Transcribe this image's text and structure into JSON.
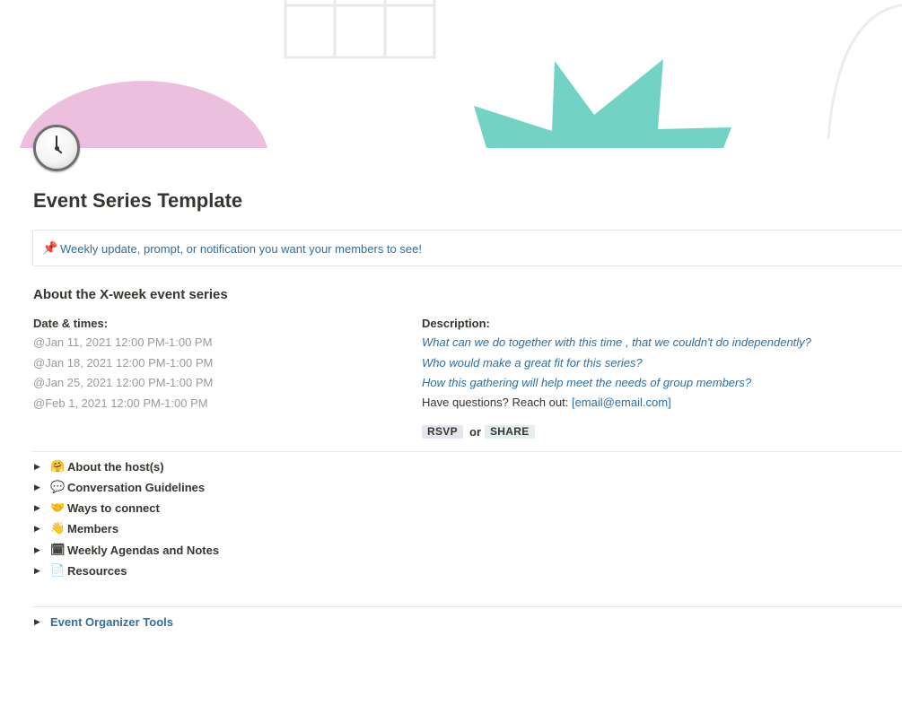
{
  "page": {
    "title": "Event Series Template",
    "icon": "clock-icon"
  },
  "callout": {
    "icon": "📌",
    "text": "Weekly update, prompt, or notification you want your members to see!"
  },
  "about": {
    "heading": "About the X-week event series",
    "dates_header": "Date & times:",
    "dates": [
      "@Jan 11, 2021 12:00 PM-1:00 PM",
      "@Jan 18, 2021 12:00 PM-1:00 PM",
      "@Jan 25, 2021 12:00 PM-1:00 PM",
      "@Feb 1, 2021 12:00 PM-1:00 PM"
    ],
    "description_header": "Description:",
    "questions": [
      "What can we do together with this time , that we couldn't do independently?",
      "Who would make a great fit for this series?",
      "How this gathering will help meet the needs of group members?"
    ],
    "contact_prefix": "Have questions? Reach out:",
    "contact_email": "[email@email.com]",
    "rsvp_label": "RSVP",
    "or_label": "or",
    "share_label": "SHARE"
  },
  "toggles": [
    {
      "emoji": "🤗",
      "label": "About the host(s)"
    },
    {
      "emoji": "💬",
      "label": "Conversation Guidelines"
    },
    {
      "emoji": "🤝",
      "label": "Ways to connect"
    },
    {
      "emoji": "👋",
      "label": "Members"
    },
    {
      "emoji": "🗓",
      "label": "Weekly Agendas and Notes"
    },
    {
      "emoji": "📄",
      "label": "Resources"
    }
  ],
  "organizer": {
    "label": "Event Organizer Tools"
  },
  "colors": {
    "cover_pink": "#ecbfdf",
    "cover_teal": "#72d3c4",
    "link_blue": "#2e6fa0",
    "muted_gray": "#9b9a97"
  }
}
